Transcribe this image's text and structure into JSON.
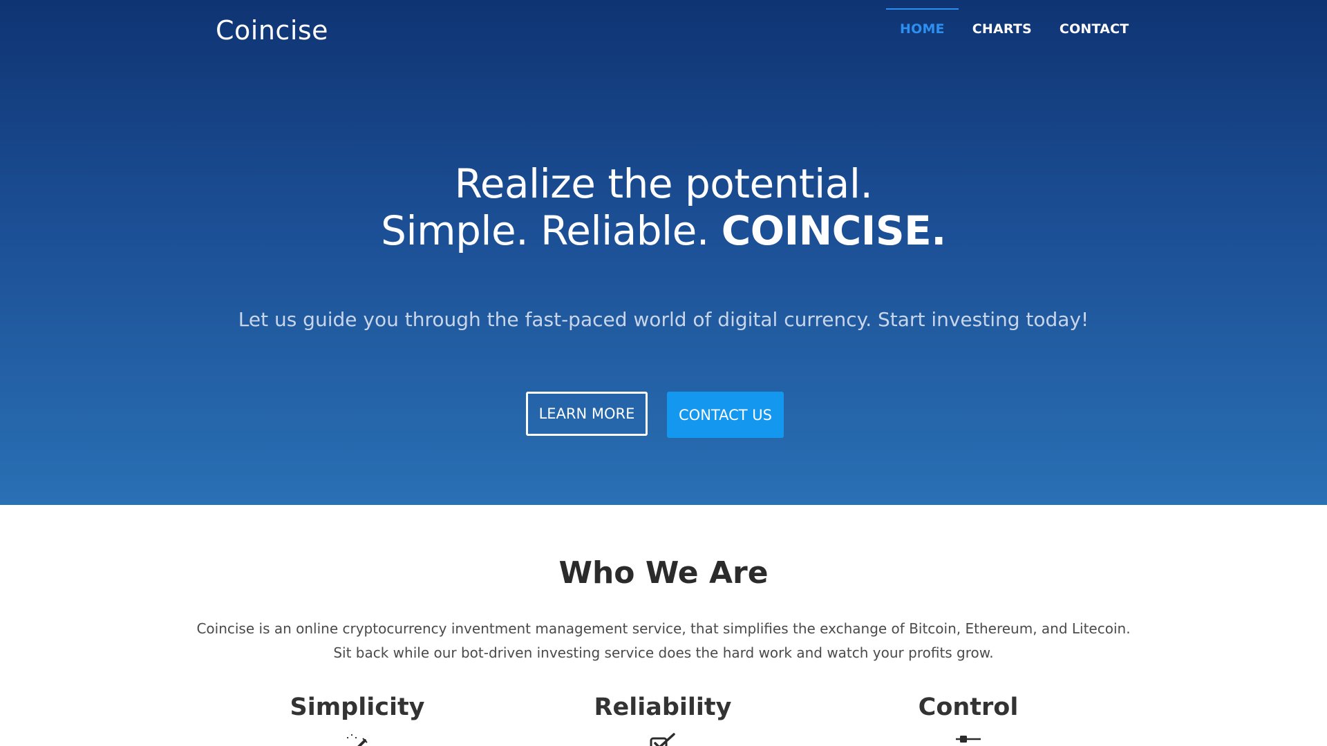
{
  "brand": {
    "name": "Coincise"
  },
  "nav": {
    "items": [
      {
        "label": "HOME",
        "active": true
      },
      {
        "label": "CHARTS",
        "active": false
      },
      {
        "label": "CONTACT",
        "active": false
      }
    ],
    "active_color": "#2d90f0"
  },
  "hero": {
    "headline_line1": "Realize the potential.",
    "headline_line2_prefix": "Simple. Reliable.",
    "headline_line2_strong": "COINCISE.",
    "subtitle": "Let us guide you through the fast-paced world of digital currency. Start investing today!",
    "learn_more_label": "LEARN MORE",
    "contact_us_label": "CONTACT US",
    "gradient_top": "#0f3473",
    "gradient_bottom": "#2a70b4",
    "button_primary_color": "#1397ef"
  },
  "about": {
    "title": "Who We Are",
    "text_line1": "Coincise is an online cryptocurrency inventment management service, that simplifies the exchange of Bitcoin, Ethereum, and Litecoin.",
    "text_line2": "Sit back while our bot-driven investing service does the hard work and watch your profits grow.",
    "features": [
      {
        "title": "Simplicity",
        "icon": "magic-wand-icon"
      },
      {
        "title": "Reliability",
        "icon": "check-square-icon"
      },
      {
        "title": "Control",
        "icon": "slider-control-icon"
      }
    ]
  }
}
